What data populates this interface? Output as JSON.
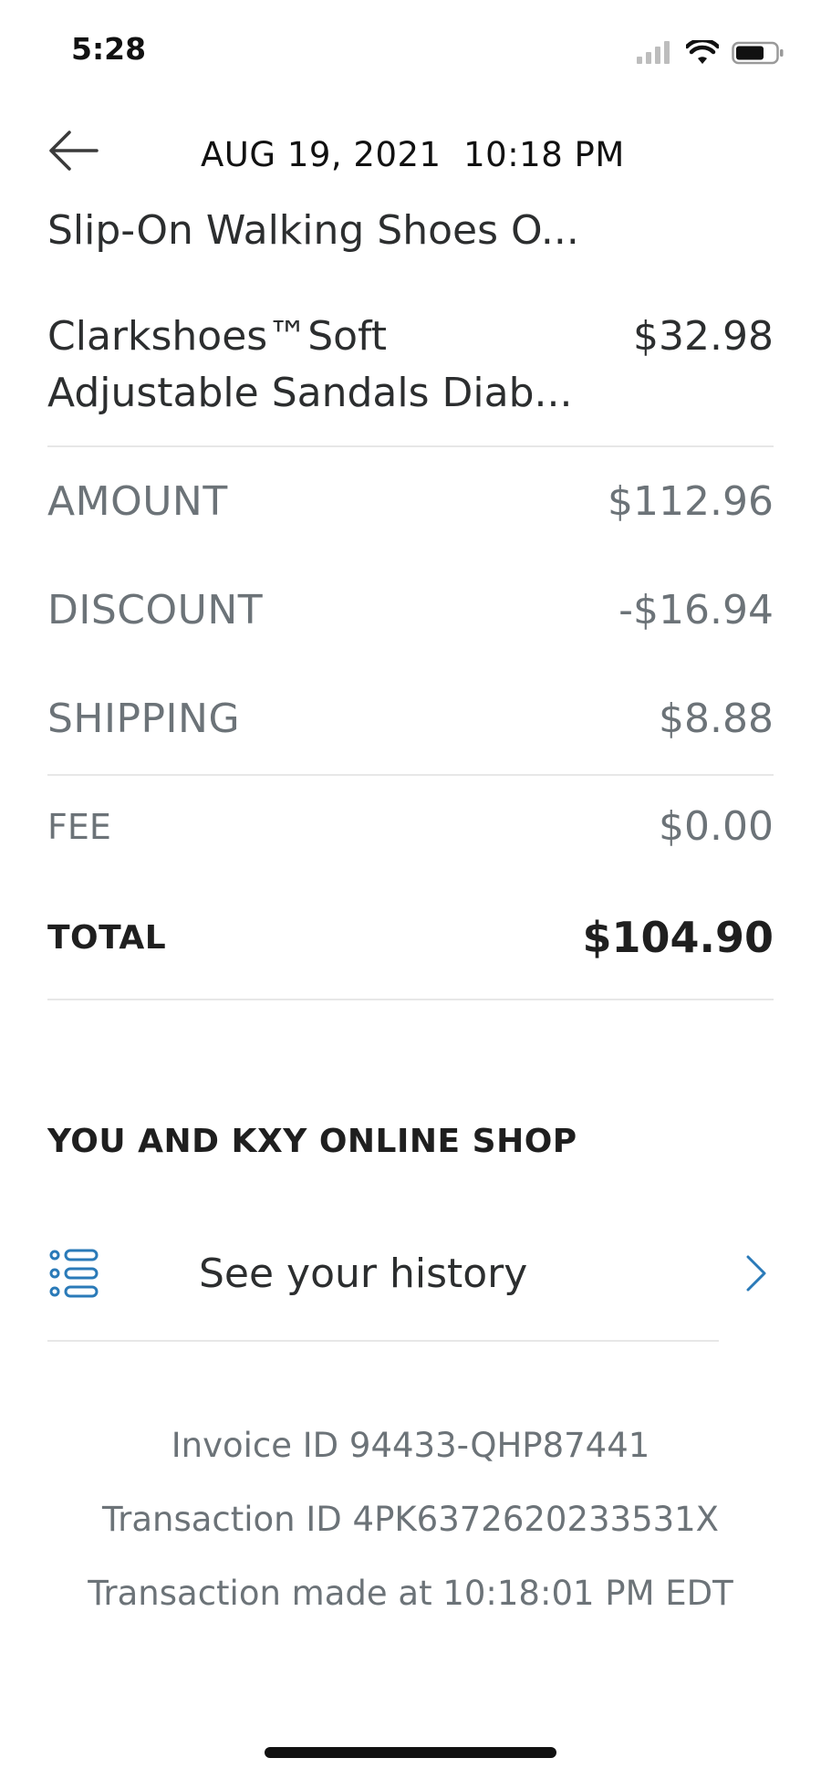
{
  "status_bar": {
    "time": "5:28"
  },
  "header": {
    "date_time": "AUG 19, 2021  10:18 PM"
  },
  "items": [
    {
      "name": "Slip-On Walking Shoes O...",
      "price": ""
    },
    {
      "name": "Clarkshoes™Soft\nAdjustable Sandals Diab...",
      "price": "$32.98"
    }
  ],
  "summary": {
    "amount_label": "AMOUNT",
    "amount_value": "$112.96",
    "discount_label": "DISCOUNT",
    "discount_value": "-$16.94",
    "shipping_label": "SHIPPING",
    "shipping_value": "$8.88",
    "fee_label": "FEE",
    "fee_value": "$0.00",
    "total_label": "TOTAL",
    "total_value": "$104.90"
  },
  "relationship": {
    "title": "YOU AND KXY ONLINE SHOP",
    "history_label": "See your history"
  },
  "footer": {
    "invoice": "Invoice ID 94433-QHP87441",
    "transaction": "Transaction ID 4PK6372620233531X",
    "made_at": "Transaction made at 10:18:01 PM EDT"
  },
  "colors": {
    "accent": "#2a7ab8",
    "text": "#2c2e2f",
    "muted": "#6c7378",
    "divider": "#e7e7e7"
  },
  "icons": {
    "back": "arrow-left-icon",
    "history": "list-icon",
    "chevron": "chevron-right-icon",
    "signal": "cellular-signal-icon",
    "wifi": "wifi-icon",
    "battery": "battery-icon"
  }
}
